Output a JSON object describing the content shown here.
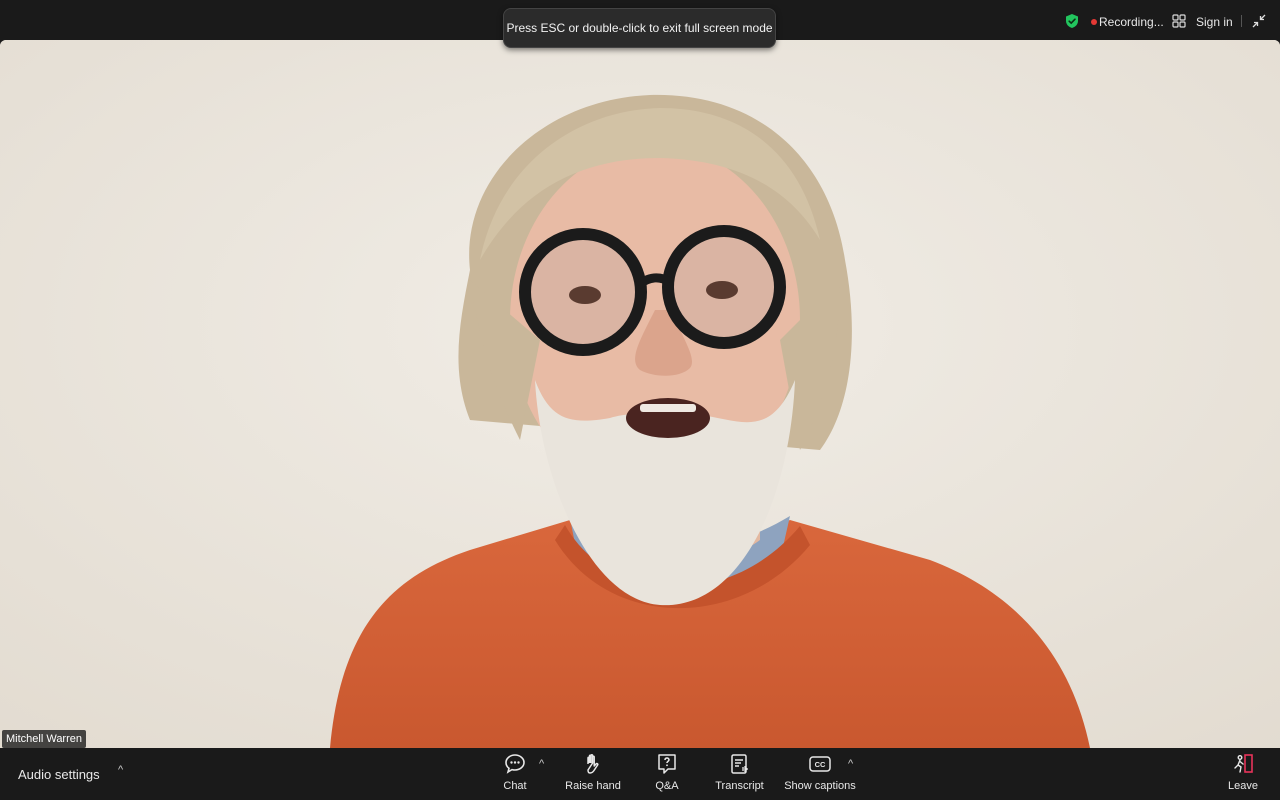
{
  "top_bar": {
    "fullscreen_tooltip": "Press ESC or double-click to exit full screen mode",
    "recording_label": "Recording...",
    "sign_in_label": "Sign in"
  },
  "video": {
    "participant_name": "Mitchell Warren"
  },
  "bottom_bar": {
    "audio_settings_label": "Audio settings",
    "tools": [
      {
        "label": "Chat",
        "icon": "chat-icon"
      },
      {
        "label": "Raise hand",
        "icon": "hand-icon"
      },
      {
        "label": "Q&A",
        "icon": "question-icon"
      },
      {
        "label": "Transcript",
        "icon": "transcript-icon"
      },
      {
        "label": "Show captions",
        "icon": "captions-icon"
      }
    ],
    "leave_label": "Leave"
  },
  "colors": {
    "background": "#1a1a1a",
    "recording_dot": "#e53935",
    "shield": "#22c55e",
    "leave_accent": "#e8335a"
  }
}
